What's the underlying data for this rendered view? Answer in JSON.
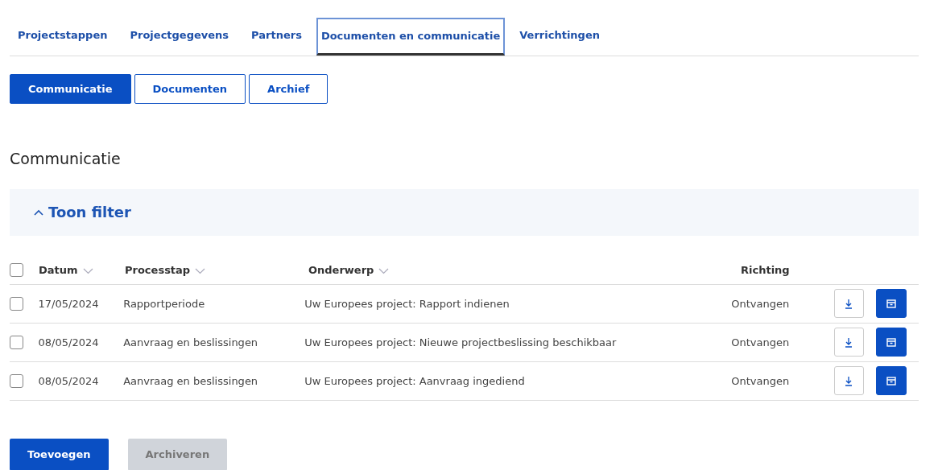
{
  "tabs": [
    {
      "label": "Projectstappen",
      "selected": false
    },
    {
      "label": "Projectgegevens",
      "selected": false
    },
    {
      "label": "Partners",
      "selected": false
    },
    {
      "label": "Documenten en communicatie",
      "selected": true
    },
    {
      "label": "Verrichtingen",
      "selected": false
    }
  ],
  "subtabs": [
    {
      "label": "Communicatie",
      "selected": true
    },
    {
      "label": "Documenten",
      "selected": false
    },
    {
      "label": "Archief",
      "selected": false
    }
  ],
  "heading": "Communicatie",
  "filter": {
    "label": "Toon filter",
    "expanded": true
  },
  "table": {
    "select_all": {
      "checked": false
    },
    "columns": [
      {
        "label": "Datum",
        "sortable": true
      },
      {
        "label": "Processtap",
        "sortable": true
      },
      {
        "label": "Onderwerp",
        "sortable": true
      },
      {
        "label": "Richting",
        "sortable": false
      }
    ],
    "rows": [
      {
        "checked": false,
        "cells": [
          "17/05/2024",
          "Rapportperiode",
          "Uw Europees project: Rapport indienen",
          "Ontvangen"
        ]
      },
      {
        "checked": false,
        "cells": [
          "08/05/2024",
          "Aanvraag en beslissingen",
          "Uw Europees project: Nieuwe projectbeslissing beschikbaar",
          "Ontvangen"
        ]
      },
      {
        "checked": false,
        "cells": [
          "08/05/2024",
          "Aanvraag en beslissingen",
          "Uw Europees project: Aanvraag ingediend",
          "Ontvangen"
        ]
      }
    ]
  },
  "buttons": [
    {
      "label": "Toevoegen",
      "disabled": false
    },
    {
      "label": "Archiveren",
      "disabled": true
    }
  ]
}
